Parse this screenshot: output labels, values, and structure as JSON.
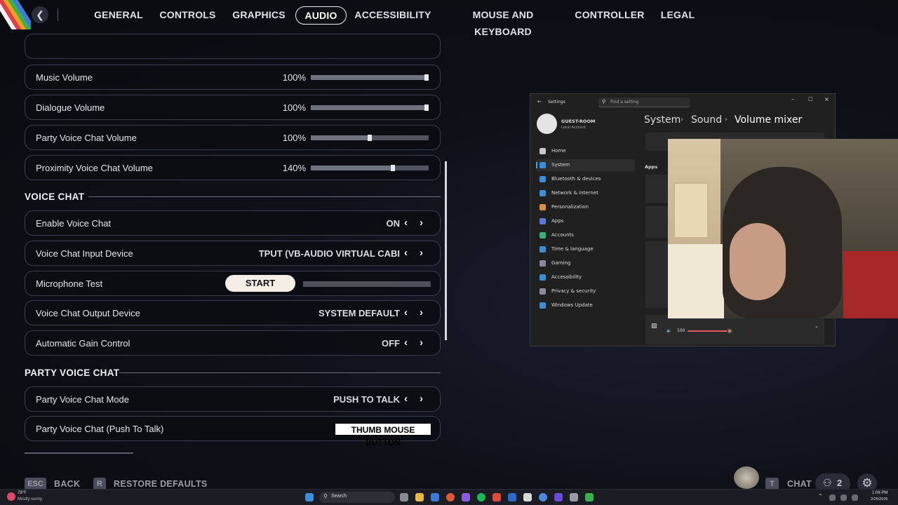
{
  "nav": {
    "tabs": [
      "GENERAL",
      "CONTROLS",
      "GRAPHICS",
      "AUDIO",
      "ACCESSIBILITY",
      "MOUSE AND KEYBOARD",
      "CONTROLLER",
      "LEGAL"
    ],
    "active_tab": "AUDIO"
  },
  "audio": {
    "music_volume": {
      "label": "Music Volume",
      "value": "100%",
      "level": 1.0
    },
    "dialogue_volume": {
      "label": "Dialogue Volume",
      "value": "100%",
      "level": 1.0
    },
    "party_voice_volume": {
      "label": "Party Voice Chat Volume",
      "value": "100%",
      "level": 0.5
    },
    "proximity_voice_volume": {
      "label": "Proximity Voice Chat Volume",
      "value": "140%",
      "level": 0.7
    }
  },
  "voice_chat": {
    "heading": "VOICE CHAT",
    "enable": {
      "label": "Enable Voice Chat",
      "value": "ON"
    },
    "input_device": {
      "label": "Voice Chat Input Device",
      "value": "TPUT (VB-AUDIO VIRTUAL CABI"
    },
    "mic_test": {
      "label": "Microphone Test",
      "button": "START"
    },
    "output_device": {
      "label": "Voice Chat Output Device",
      "value": "SYSTEM DEFAULT"
    },
    "agc": {
      "label": "Automatic Gain Control",
      "value": "OFF"
    }
  },
  "party_voice_chat": {
    "heading": "PARTY VOICE CHAT",
    "mode": {
      "label": "Party Voice Chat Mode",
      "value": "PUSH TO TALK"
    },
    "ptt": {
      "label": "Party Voice Chat (Push To Talk)",
      "value": "THUMB MOUSE BUTTON"
    }
  },
  "footer": {
    "back_key": "ESC",
    "back_label": "BACK",
    "restore_key": "R",
    "restore_label": "RESTORE DEFAULTS",
    "chat_key": "T",
    "chat_label": "CHAT",
    "party_count": "2"
  },
  "windows_settings": {
    "title": "Settings",
    "search_placeholder": "Find a setting",
    "user_name": "GUEST-ROOM",
    "user_sub": "Local Account",
    "breadcrumb": [
      "System",
      "Sound",
      "Volume mixer"
    ],
    "apps_heading": "Apps",
    "volume_value": "100",
    "nav": [
      {
        "label": "Home",
        "color": "#c8c8c8"
      },
      {
        "label": "System",
        "color": "#3a8fd8"
      },
      {
        "label": "Bluetooth & devices",
        "color": "#3a8fd8"
      },
      {
        "label": "Network & internet",
        "color": "#3a8fd8"
      },
      {
        "label": "Personalization",
        "color": "#e09040"
      },
      {
        "label": "Apps",
        "color": "#5a7ad8"
      },
      {
        "label": "Accounts",
        "color": "#3ab07a"
      },
      {
        "label": "Time & language",
        "color": "#3a8fd8"
      },
      {
        "label": "Gaming",
        "color": "#8a8a9a"
      },
      {
        "label": "Accessibility",
        "color": "#3a8fd8"
      },
      {
        "label": "Privacy & security",
        "color": "#8a8a9a"
      },
      {
        "label": "Windows Update",
        "color": "#3a8fd8"
      }
    ]
  },
  "taskbar": {
    "weather_temp": "78°F",
    "weather_desc": "Mostly sunny",
    "search_label": "Search",
    "time": "1:06 PM",
    "date": "2/25/2026"
  },
  "colors": {
    "accent_pink": "#e0486a",
    "background": "#0f1119"
  }
}
